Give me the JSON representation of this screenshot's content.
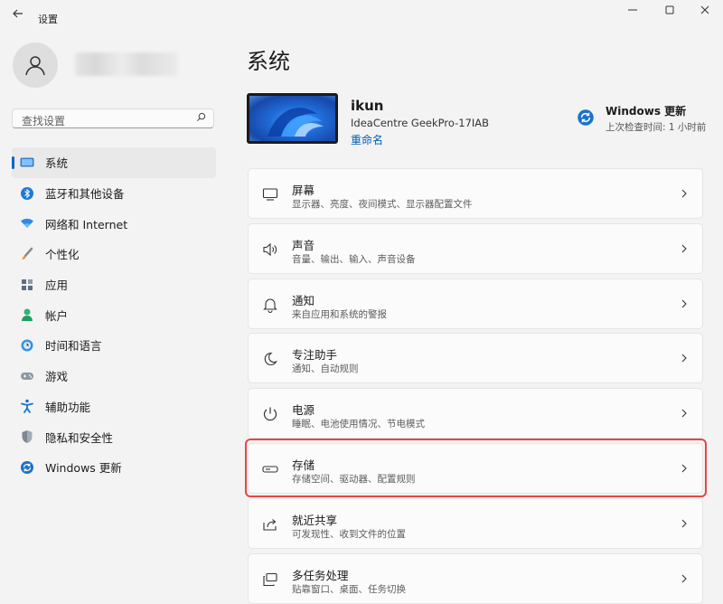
{
  "window": {
    "back_icon": "back-arrow-icon",
    "title": "设置",
    "controls": [
      "minimize-icon",
      "maximize-icon",
      "close-icon"
    ]
  },
  "user": {
    "avatar_icon": "person-icon"
  },
  "search": {
    "placeholder": "查找设置",
    "icon": "search-icon"
  },
  "sidebar": {
    "items": [
      {
        "label": "系统",
        "icon": "monitor-icon",
        "selected": true
      },
      {
        "label": "蓝牙和其他设备",
        "icon": "bluetooth-icon"
      },
      {
        "label": "网络和 Internet",
        "icon": "wifi-icon"
      },
      {
        "label": "个性化",
        "icon": "brush-icon"
      },
      {
        "label": "应用",
        "icon": "apps-icon"
      },
      {
        "label": "帐户",
        "icon": "person-icon"
      },
      {
        "label": "时间和语言",
        "icon": "globe-clock-icon"
      },
      {
        "label": "游戏",
        "icon": "gamepad-icon"
      },
      {
        "label": "辅助功能",
        "icon": "accessibility-icon"
      },
      {
        "label": "隐私和安全性",
        "icon": "shield-icon"
      },
      {
        "label": "Windows 更新",
        "icon": "update-icon"
      }
    ]
  },
  "main": {
    "title": "系统",
    "device": {
      "name": "ikun",
      "model": "IdeaCentre GeekPro-17IAB",
      "rename": "重命名"
    },
    "windows_update": {
      "title": "Windows 更新",
      "subtitle": "上次检查时间: 1 小时前"
    },
    "cards": [
      {
        "title": "屏幕",
        "subtitle": "显示器、亮度、夜间模式、显示器配置文件",
        "icon": "display-icon"
      },
      {
        "title": "声音",
        "subtitle": "音量、输出、输入、声音设备",
        "icon": "speaker-icon"
      },
      {
        "title": "通知",
        "subtitle": "来自应用和系统的警报",
        "icon": "bell-icon"
      },
      {
        "title": "专注助手",
        "subtitle": "通知、自动规则",
        "icon": "moon-icon"
      },
      {
        "title": "电源",
        "subtitle": "睡眠、电池使用情况、节电模式",
        "icon": "power-icon"
      },
      {
        "title": "存储",
        "subtitle": "存储空间、驱动器、配置规则",
        "icon": "storage-drive-icon",
        "highlighted": true
      },
      {
        "title": "就近共享",
        "subtitle": "可发现性、收到文件的位置",
        "icon": "share-icon"
      },
      {
        "title": "多任务处理",
        "subtitle": "贴靠窗口、桌面、任务切换",
        "icon": "multitask-icon"
      }
    ]
  },
  "colors": {
    "accent": "#0067c0",
    "highlight": "#e34848",
    "background": "#f3f3f3",
    "card": "#fbfbfb"
  }
}
